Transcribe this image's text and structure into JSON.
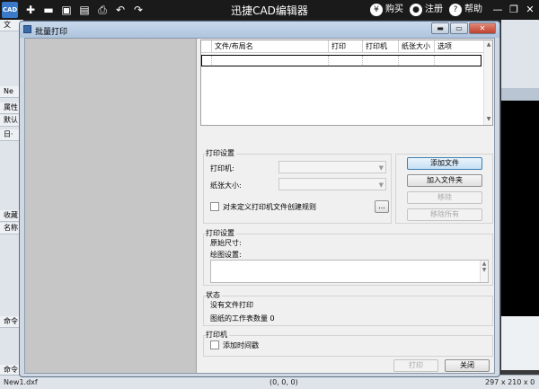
{
  "app": {
    "logo_text": "CAD",
    "title": "迅捷CAD编辑器",
    "actions": [
      {
        "icon": "yen-icon",
        "glyph": "¥",
        "label": "购买"
      },
      {
        "icon": "user-icon",
        "glyph": "●",
        "label": "注册"
      },
      {
        "icon": "help-icon",
        "glyph": "?",
        "label": "帮助"
      }
    ],
    "window_controls": {
      "minimize": "—",
      "restore": "❐",
      "close": "✕"
    },
    "toolbar_glyphs": {
      "new": "✚",
      "open": "▬",
      "save": "▣",
      "saveas": "▤",
      "print": "⎙",
      "undo": "↶",
      "redo": "↷"
    }
  },
  "background": {
    "left_fragments": [
      "文",
      "Ne",
      "属性",
      "默认",
      "日·",
      "收藏",
      "名称",
      "命令",
      "命令"
    ],
    "status_file": "New1.dxf",
    "status_coords": "(0, 0, 0)",
    "status_size": "297 x 210 x 0"
  },
  "dialog": {
    "title": "批量打印",
    "controls": {
      "minimize": "▬",
      "maximize": "▭",
      "close": "✕"
    },
    "table": {
      "columns": [
        "文件/布局名",
        "打印",
        "打印机",
        "纸张大小",
        "选项"
      ]
    },
    "print_settings": {
      "group_label": "打印设置",
      "printer_label": "打印机:",
      "paper_label": "纸张大小:",
      "custom_rule_label": "对未定义打印机文件创建规则",
      "browse_button": "...",
      "add_file": "添加文件",
      "add_folder": "加入文件夹",
      "remove": "移除",
      "remove_all": "移除所有"
    },
    "plot_settings": {
      "group_label": "打印设置",
      "original_size_label": "原始尺寸:",
      "plot_setting_label": "绘图设置:"
    },
    "status": {
      "group_label": "状态",
      "line1": "没有文件打印",
      "line2": "图纸的工作表数量 0"
    },
    "printer_group": {
      "group_label": "打印机",
      "add_timestamp": "添加时间戳"
    },
    "footer": {
      "print": "打印",
      "close": "关闭"
    }
  }
}
